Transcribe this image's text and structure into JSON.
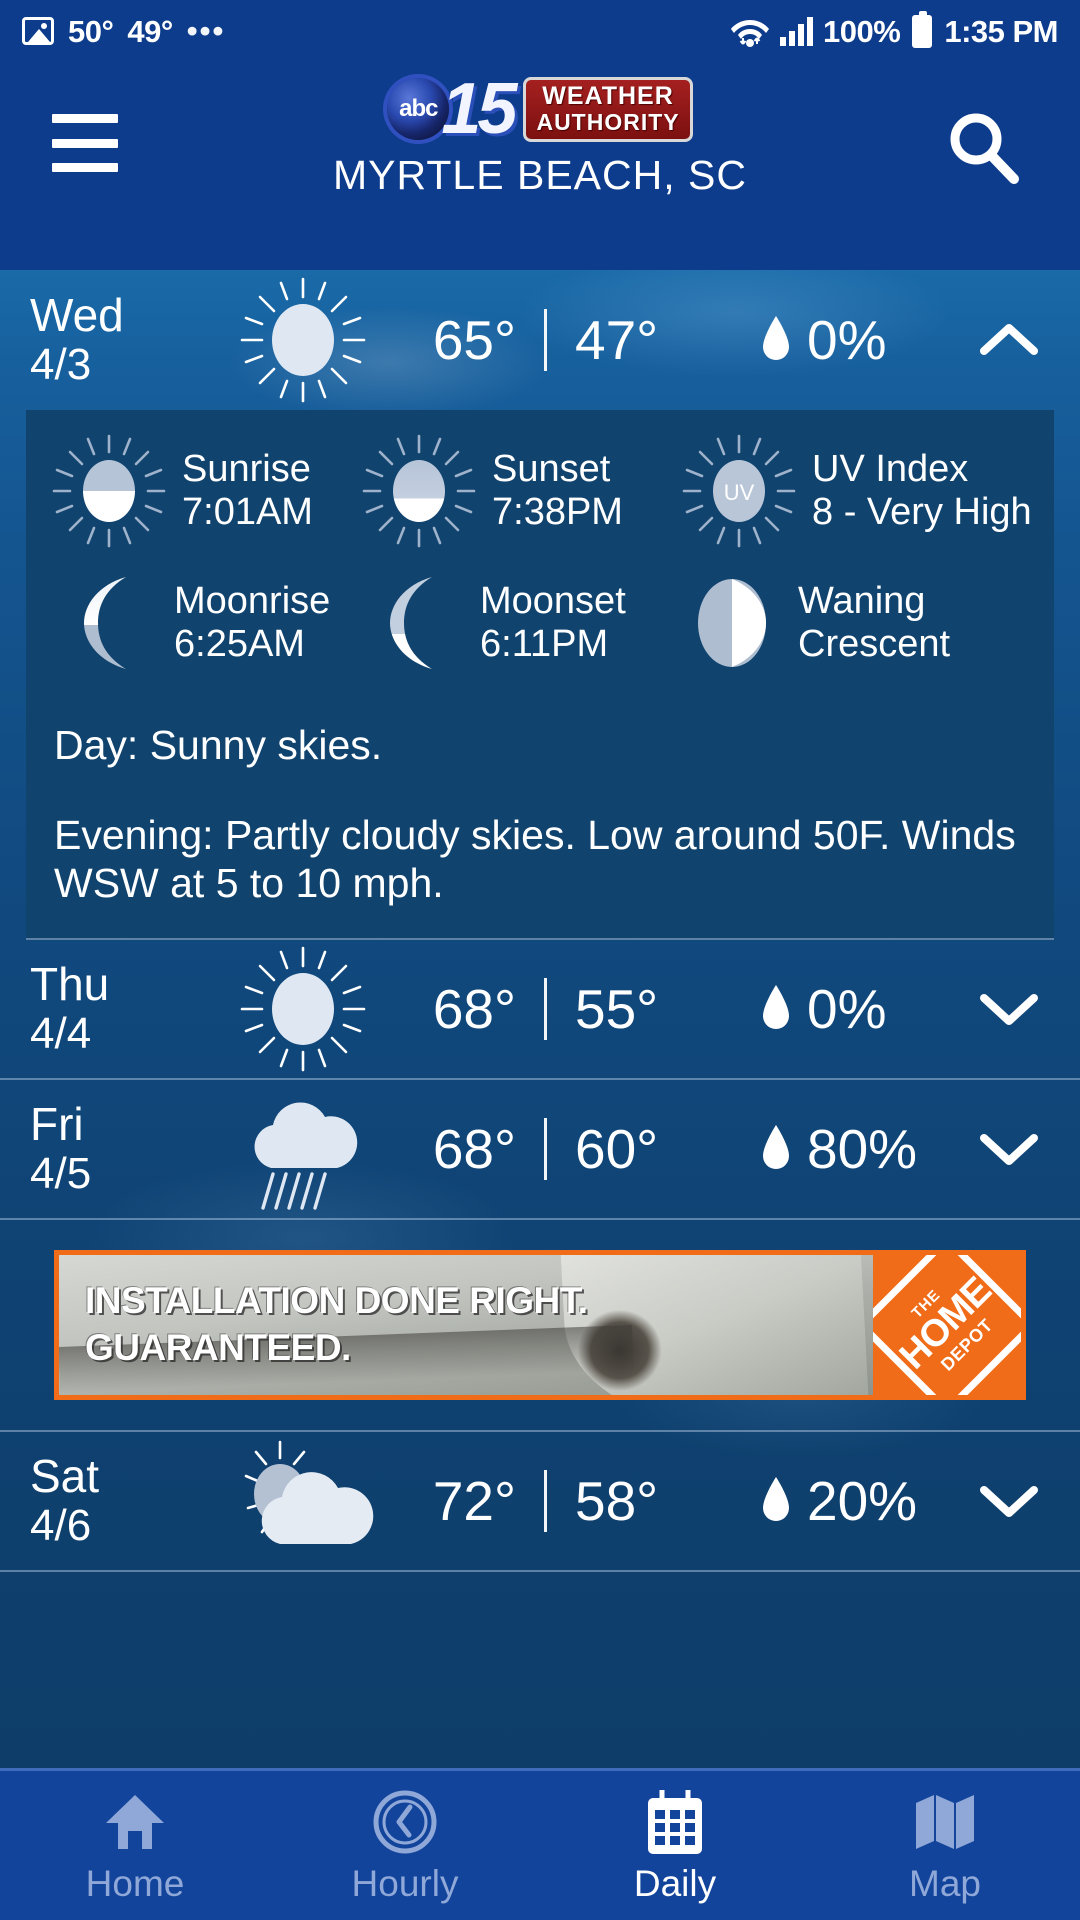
{
  "statusbar": {
    "temp_high": "50°",
    "temp_low": "49°",
    "overflow_dots": "•••",
    "battery_percent": "100%",
    "clock": "1:35 PM"
  },
  "header": {
    "logo_abc": "abc",
    "logo_channel": "15",
    "logo_weather": "WEATHER",
    "logo_authority": "AUTHORITY",
    "location": "MYRTLE BEACH, SC"
  },
  "forecast": [
    {
      "day": "Wed",
      "date": "4/3",
      "icon": "sunny",
      "high": "65°",
      "low": "47°",
      "pop": "0%",
      "expanded": true,
      "detail": {
        "sunrise_label": "Sunrise",
        "sunrise_value": "7:01AM",
        "sunset_label": "Sunset",
        "sunset_value": "7:38PM",
        "uv_label": "UV Index",
        "uv_value": "8 - Very High",
        "uv_badge": "UV",
        "moonrise_label": "Moonrise",
        "moonrise_value": "6:25AM",
        "moonset_label": "Moonset",
        "moonset_value": "6:11PM",
        "phase_label": "Waning",
        "phase_value": "Crescent",
        "narrative_day": "Day: Sunny skies.",
        "narrative_evening": "Evening: Partly cloudy skies. Low around 50F. Winds WSW at 5 to 10 mph."
      }
    },
    {
      "day": "Thu",
      "date": "4/4",
      "icon": "sunny",
      "high": "68°",
      "low": "55°",
      "pop": "0%",
      "expanded": false
    },
    {
      "day": "Fri",
      "date": "4/5",
      "icon": "rain",
      "high": "68°",
      "low": "60°",
      "pop": "80%",
      "expanded": false
    },
    {
      "day": "Sat",
      "date": "4/6",
      "icon": "partly-cloudy",
      "high": "72°",
      "low": "58°",
      "pop": "20%",
      "expanded": false
    }
  ],
  "ad": {
    "line1": "INSTALLATION DONE RIGHT.",
    "line2": "GUARANTEED.",
    "logo_the": "THE",
    "logo_home": "HOME",
    "logo_depot": "DEPOT"
  },
  "bottomnav": {
    "items": [
      {
        "label": "Home",
        "icon": "home-icon",
        "active": false
      },
      {
        "label": "Hourly",
        "icon": "clock-icon",
        "active": false
      },
      {
        "label": "Daily",
        "icon": "calendar-icon",
        "active": true
      },
      {
        "label": "Map",
        "icon": "map-icon",
        "active": false
      }
    ]
  },
  "colors": {
    "header_blue": "#0d3c8c",
    "nav_blue": "#12449b",
    "panel_blue": "#10436e",
    "accent_orange": "#f06c18",
    "ad_red": "#a52020"
  }
}
